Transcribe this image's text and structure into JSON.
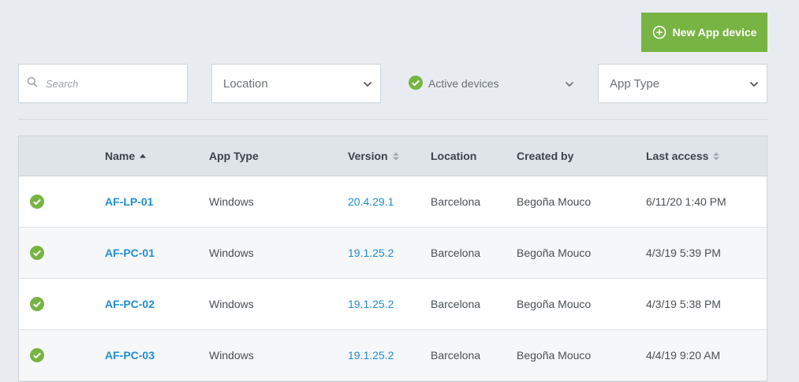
{
  "header": {
    "new_button_label": "New App device"
  },
  "filters": {
    "search_placeholder": "Search",
    "location_label": "Location",
    "active_label": "Active devices",
    "apptype_label": "App Type"
  },
  "table": {
    "columns": {
      "name": "Name",
      "app_type": "App Type",
      "version": "Version",
      "location": "Location",
      "created_by": "Created by",
      "last_access": "Last access"
    },
    "rows": [
      {
        "status": "active",
        "name": "AF-LP-01",
        "app_type": "Windows",
        "version": "20.4.29.1",
        "location": "Barcelona",
        "created_by": "Begoña Mouco",
        "last_access": "6/11/20 1:40 PM"
      },
      {
        "status": "active",
        "name": "AF-PC-01",
        "app_type": "Windows",
        "version": "19.1.25.2",
        "location": "Barcelona",
        "created_by": "Begoña Mouco",
        "last_access": "4/3/19 5:39 PM"
      },
      {
        "status": "active",
        "name": "AF-PC-02",
        "app_type": "Windows",
        "version": "19.1.25.2",
        "location": "Barcelona",
        "created_by": "Begoña Mouco",
        "last_access": "4/3/19 5:38 PM"
      },
      {
        "status": "active",
        "name": "AF-PC-03",
        "app_type": "Windows",
        "version": "19.1.25.2",
        "location": "Barcelona",
        "created_by": "Begoña Mouco",
        "last_access": "4/4/19 9:20 AM"
      }
    ]
  },
  "colors": {
    "accent_green": "#78b443",
    "link_blue": "#1f8ed2",
    "check_green": "#78b443"
  }
}
